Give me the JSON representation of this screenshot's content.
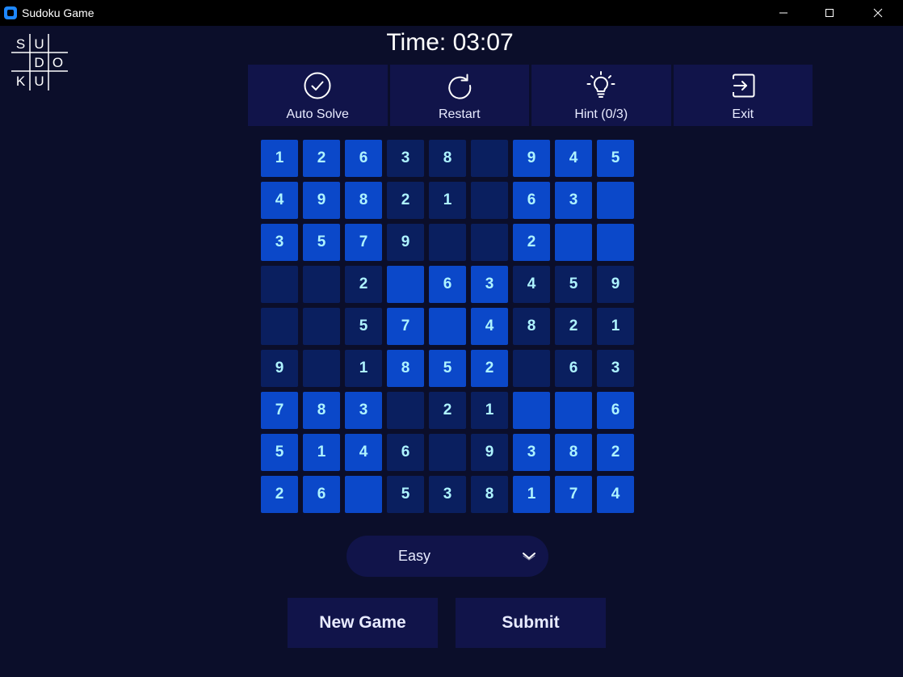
{
  "window": {
    "title": "Sudoku Game"
  },
  "logo": {
    "letters": [
      "S",
      "U",
      "D",
      "O",
      "K",
      "U"
    ]
  },
  "timer": {
    "label": "Time: 03:07"
  },
  "toolbar": {
    "buttons": [
      {
        "label": "Auto Solve",
        "icon": "check-circle-icon"
      },
      {
        "label": "Restart",
        "icon": "restart-icon"
      },
      {
        "label": "Hint (0/3)",
        "icon": "lightbulb-icon"
      },
      {
        "label": "Exit",
        "icon": "exit-icon"
      }
    ]
  },
  "board": {
    "values": [
      [
        "1",
        "2",
        "6",
        "3",
        "8",
        "",
        "9",
        "4",
        "5"
      ],
      [
        "4",
        "9",
        "8",
        "2",
        "1",
        "",
        "6",
        "3",
        ""
      ],
      [
        "3",
        "5",
        "7",
        "9",
        "",
        "",
        "2",
        "",
        ""
      ],
      [
        "",
        "",
        "2",
        "",
        "6",
        "3",
        "4",
        "5",
        "9"
      ],
      [
        "",
        "",
        "5",
        "7",
        "",
        "4",
        "8",
        "2",
        "1"
      ],
      [
        "9",
        "",
        "1",
        "8",
        "5",
        "2",
        "",
        "6",
        "3"
      ],
      [
        "7",
        "8",
        "3",
        "",
        "2",
        "1",
        "",
        "",
        "6"
      ],
      [
        "5",
        "1",
        "4",
        "6",
        "",
        "9",
        "3",
        "8",
        "2"
      ],
      [
        "2",
        "6",
        "",
        "5",
        "3",
        "8",
        "1",
        "7",
        "4"
      ]
    ]
  },
  "difficulty": {
    "selected": "Easy"
  },
  "actions": {
    "new_game": "New Game",
    "submit": "Submit"
  },
  "colors": {
    "background": "#0b0e2a",
    "panel": "#11144a",
    "cell_bright": "#0b48c9",
    "cell_dark": "#0a1f5f",
    "digit": "#aef3ff"
  }
}
